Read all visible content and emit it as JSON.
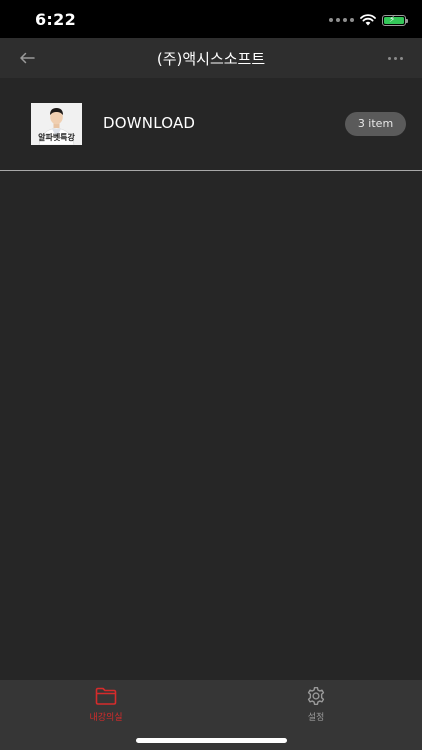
{
  "status_bar": {
    "time": "6:22",
    "icons": [
      "signal-dots-icon",
      "wifi-icon",
      "battery-charging-icon"
    ],
    "battery_color": "#34c759"
  },
  "nav": {
    "title": "(주)액시스소프트",
    "back_icon": "arrow-left-icon",
    "more_icon": "more-dots-icon"
  },
  "folders": [
    {
      "name": "DOWNLOAD",
      "count_label": "3 item",
      "thumbnail_caption": "알파벳특강"
    }
  ],
  "tabs": [
    {
      "label": "내강의실",
      "icon": "folder-icon",
      "active": true
    },
    {
      "label": "설정",
      "icon": "gear-icon",
      "active": false
    }
  ],
  "colors": {
    "accent": "#d62b2b",
    "background": "#262626",
    "nav_background": "#2e2e2e",
    "tab_background": "#363636"
  }
}
